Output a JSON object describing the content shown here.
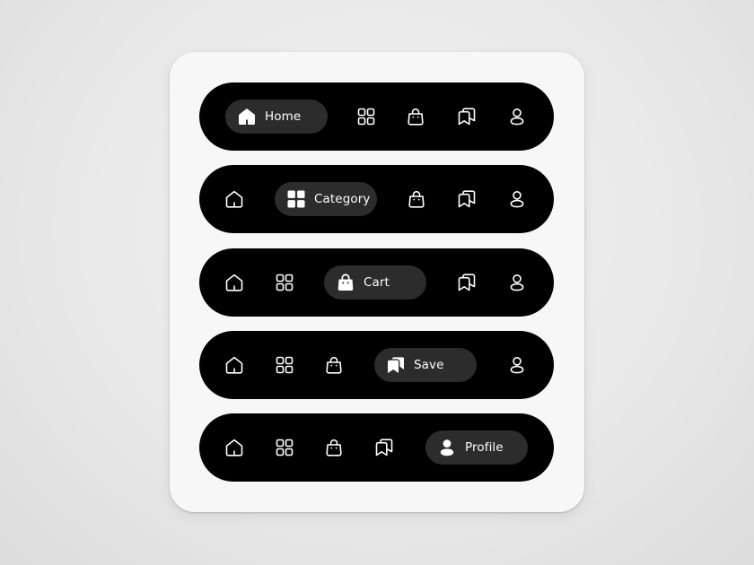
{
  "colors": {
    "background": "#e9e9e9",
    "card": "#f7f7f7",
    "bar": "#000000",
    "active_pill": "#2c2c2c",
    "icon": "#ffffff"
  },
  "icons": [
    "home-icon",
    "category-icon",
    "cart-icon",
    "save-icon",
    "profile-icon"
  ],
  "nav_bars": [
    {
      "active": "home",
      "active_label": "Home"
    },
    {
      "active": "category",
      "active_label": "Category"
    },
    {
      "active": "cart",
      "active_label": "Cart"
    },
    {
      "active": "save",
      "active_label": "Save"
    },
    {
      "active": "profile",
      "active_label": "Profile"
    }
  ]
}
